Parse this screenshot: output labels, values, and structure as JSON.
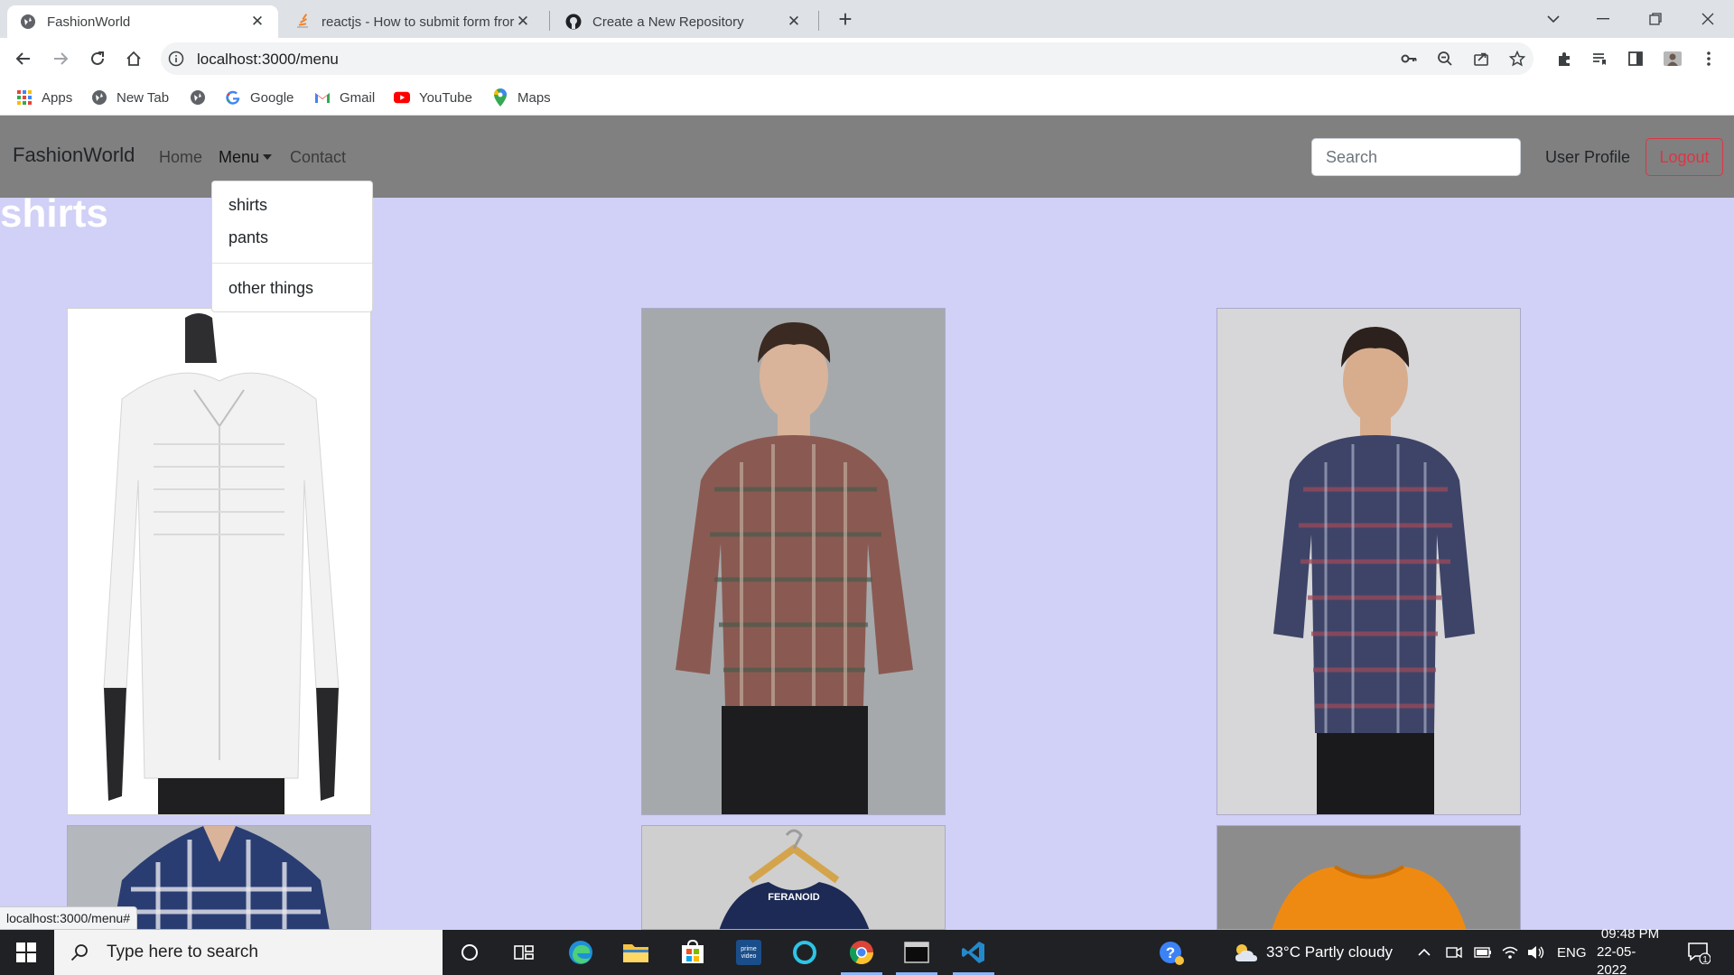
{
  "browser": {
    "tabs": [
      {
        "title": "FashionWorld",
        "active": true
      },
      {
        "title": "reactjs - How to submit form fror",
        "active": false
      },
      {
        "title": "Create a New Repository",
        "active": false
      }
    ],
    "url": "localhost:3000/menu",
    "bookmarks": [
      {
        "label": "Apps",
        "icon": "apps-grid-icon"
      },
      {
        "label": "New Tab",
        "icon": "globe-icon"
      },
      {
        "label": "",
        "icon": "globe-icon"
      },
      {
        "label": "Google",
        "icon": "google-icon"
      },
      {
        "label": "Gmail",
        "icon": "gmail-icon"
      },
      {
        "label": "YouTube",
        "icon": "youtube-icon"
      },
      {
        "label": "Maps",
        "icon": "maps-pin-icon"
      }
    ],
    "status_url": "localhost:3000/menu#"
  },
  "navbar": {
    "brand": "FashionWorld",
    "links": [
      "Home",
      "Menu",
      "Contact"
    ],
    "search_placeholder": "Search",
    "profile": "User Profile",
    "logout": "Logout"
  },
  "dropdown": {
    "items": [
      "shirts",
      "pants",
      "other things"
    ]
  },
  "page": {
    "heading": "shirts",
    "products": [
      {
        "name": "white-shirt-on-mannequin",
        "colors": {
          "shirt": "#f2f2f2",
          "bg": "#ffffff"
        }
      },
      {
        "name": "red-green-check-shirt",
        "colors": {
          "shirt": "#8a5a52",
          "bg": "#a6a9ab"
        }
      },
      {
        "name": "navy-red-check-shirt",
        "colors": {
          "shirt": "#3e4468",
          "bg": "#d7d7d9"
        }
      },
      {
        "name": "blue-check-shirt",
        "colors": {
          "shirt": "#2a3d72",
          "bg": "#b4b8bd"
        }
      },
      {
        "name": "navy-shirt-on-hanger",
        "colors": {
          "shirt": "#1c2a55",
          "bg": "#cfcfcf"
        }
      },
      {
        "name": "orange-tshirt",
        "colors": {
          "shirt": "#ee8a12",
          "bg": "#8c8c8c"
        }
      }
    ],
    "hanger_label": "FERANOID",
    "background": "#d1d0f7",
    "navbar_color": "#808080"
  },
  "taskbar": {
    "search_placeholder": "Type here to search",
    "weather": "33°C  Partly cloudy",
    "language": "ENG",
    "time": "09:48 PM",
    "date": "22-05-2022",
    "notification_count": "1"
  }
}
